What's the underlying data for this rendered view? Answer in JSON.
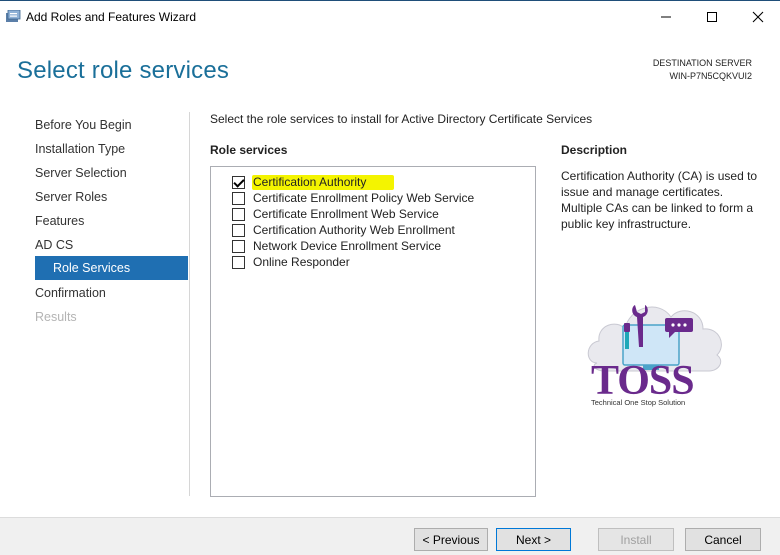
{
  "window": {
    "title": "Add Roles and Features Wizard",
    "minimize_icon": "minimize-icon",
    "maximize_icon": "maximize-icon",
    "close_icon": "close-icon"
  },
  "header": {
    "page_title": "Select role services",
    "destination_label": "DESTINATION SERVER",
    "destination_server": "WIN-P7N5CQKVUI2"
  },
  "nav": {
    "items": [
      {
        "label": "Before You Begin",
        "state": "normal"
      },
      {
        "label": "Installation Type",
        "state": "normal"
      },
      {
        "label": "Server Selection",
        "state": "normal"
      },
      {
        "label": "Server Roles",
        "state": "normal"
      },
      {
        "label": "Features",
        "state": "normal"
      },
      {
        "label": "AD CS",
        "state": "normal"
      },
      {
        "label": "Role Services",
        "state": "active"
      },
      {
        "label": "Confirmation",
        "state": "normal"
      },
      {
        "label": "Results",
        "state": "disabled"
      }
    ]
  },
  "main": {
    "instruction": "Select the role services to install for Active Directory Certificate Services",
    "role_services_header": "Role services",
    "role_services": [
      {
        "label": "Certification Authority",
        "checked": true,
        "highlighted": true
      },
      {
        "label": "Certificate Enrollment Policy Web Service",
        "checked": false,
        "highlighted": false
      },
      {
        "label": "Certificate Enrollment Web Service",
        "checked": false,
        "highlighted": false
      },
      {
        "label": "Certification Authority Web Enrollment",
        "checked": false,
        "highlighted": false
      },
      {
        "label": "Network Device Enrollment Service",
        "checked": false,
        "highlighted": false
      },
      {
        "label": "Online Responder",
        "checked": false,
        "highlighted": false
      }
    ],
    "description_header": "Description",
    "description_text": "Certification Authority (CA) is used to issue and manage certificates. Multiple CAs can be linked to form a public key infrastructure."
  },
  "watermark": {
    "logo_text": "TOSS",
    "tagline": "Technical One Stop Solution"
  },
  "footer": {
    "previous_label": "< Previous",
    "next_label": "Next >",
    "install_label": "Install",
    "cancel_label": "Cancel"
  },
  "colors": {
    "accent": "#1f6fb2",
    "title_blue": "#1a6f99",
    "highlight_yellow": "#f4f400",
    "logo_purple": "#6a2a8c",
    "logo_teal": "#1fa8b8"
  }
}
